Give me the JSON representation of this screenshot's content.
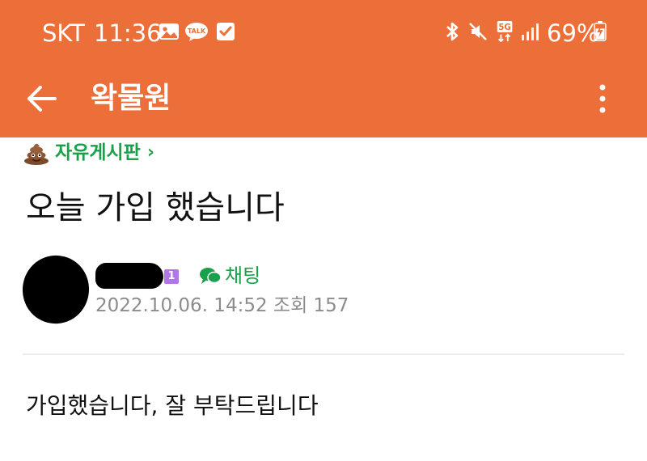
{
  "status_bar": {
    "carrier": "SKT",
    "time": "11:36",
    "notification_icons": [
      "gallery-icon",
      "kakaotalk-icon",
      "checkbox-icon"
    ],
    "kakao_badge_text": "TALK",
    "system_icons": [
      "bluetooth-icon",
      "mute-icon",
      "5g-icon",
      "signal-icon"
    ],
    "network_label": "5G",
    "battery_percent": "69%",
    "battery_level": 0.69,
    "battery_charging": true
  },
  "app_bar": {
    "title": "왁물원",
    "back_icon": "arrow-left-icon",
    "more_icon": "more-vert-icon",
    "color": "#ec6f3a"
  },
  "post": {
    "board": {
      "icon": "poop-emoji-icon",
      "label": "자유게시판",
      "chevron": "›"
    },
    "title": "오늘 가입 했습니다",
    "author": {
      "name_redacted": true,
      "level": "1",
      "level_color": "#b277e6"
    },
    "chat_label": "채팅",
    "chat_color": "#19a04a",
    "meta": "2022.10.06. 14:52  조회 157",
    "body": "가입했습니다, 잘 부탁드립니다"
  }
}
